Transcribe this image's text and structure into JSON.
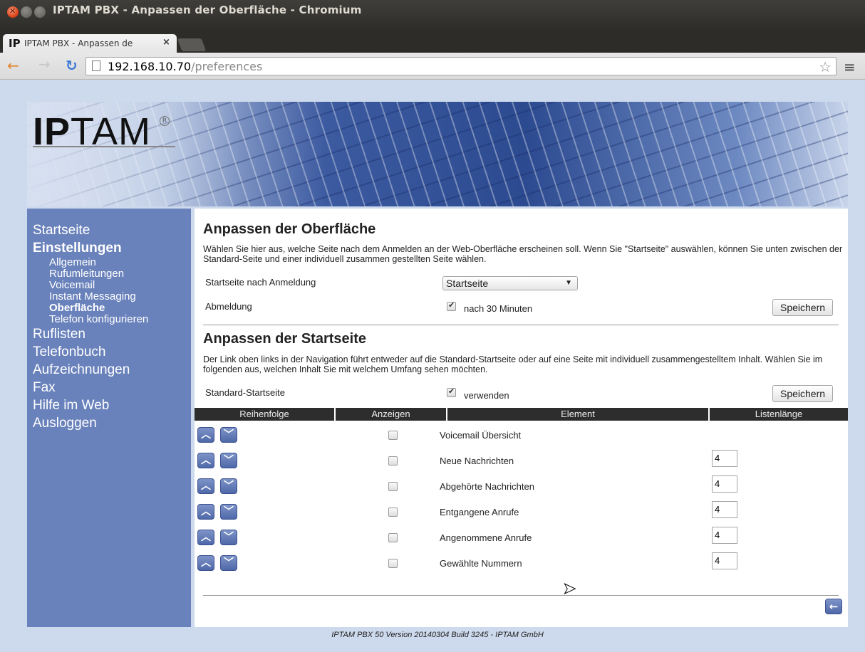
{
  "window": {
    "title": "IPTAM PBX - Anpassen der Oberfläche - Chromium"
  },
  "tab": {
    "favicon": "IP",
    "title": "IPTAM PBX - Anpassen de",
    "close": "×"
  },
  "address_bar": {
    "host": "192.168.10.70",
    "path": "/preferences"
  },
  "icons": {
    "back": "←",
    "forward": "→",
    "reload": "↻",
    "star": "☆",
    "menu": "≡",
    "up": "^",
    "down": "v",
    "page_back": "←",
    "checkmark": "✔"
  },
  "banner": {
    "logo_ip": "IP",
    "logo_tam": "TAM",
    "logo_reg": "R"
  },
  "sidebar": {
    "items": [
      {
        "label": "Startseite",
        "level": 1,
        "active": false
      },
      {
        "label": "Einstellungen",
        "level": 1,
        "active": true
      },
      {
        "label": "Allgemein",
        "level": 2,
        "active": false
      },
      {
        "label": "Rufumleitungen",
        "level": 2,
        "active": false
      },
      {
        "label": "Voicemail",
        "level": 2,
        "active": false
      },
      {
        "label": "Instant Messaging",
        "level": 2,
        "active": false
      },
      {
        "label": "Oberfläche",
        "level": 2,
        "active": true
      },
      {
        "label": "Telefon konfigurieren",
        "level": 2,
        "active": false
      },
      {
        "label": "Ruflisten",
        "level": 1,
        "active": false
      },
      {
        "label": "Telefonbuch",
        "level": 1,
        "active": false
      },
      {
        "label": "Aufzeichnungen",
        "level": 1,
        "active": false
      },
      {
        "label": "Fax",
        "level": 1,
        "active": false
      },
      {
        "label": "Hilfe im Web",
        "level": 1,
        "active": false
      },
      {
        "label": "Ausloggen",
        "level": 1,
        "active": false
      }
    ]
  },
  "section1": {
    "heading": "Anpassen der Oberfläche",
    "description": "Wählen Sie hier aus, welche Seite nach dem Anmelden an der Web-Oberfläche erscheinen soll. Wenn Sie \"Startseite\" auswählen, können Sie unten zwischen der Standard-Seite und einer individuell zusammen gestellten Seite wählen.",
    "start_label": "Startseite nach Anmeldung",
    "start_value": "Startseite",
    "logout_label": "Abmeldung",
    "logout_checked": true,
    "logout_value": "nach 30 Minuten",
    "save": "Speichern"
  },
  "section2": {
    "heading": "Anpassen der Startseite",
    "description": "Der Link oben links in der Navigation führt entweder auf die Standard-Startseite oder auf eine Seite mit individuell zusammengestelltem Inhalt. Wählen Sie im folgenden aus, welchen Inhalt Sie mit welchem Umfang sehen möchten.",
    "standard_label": "Standard-Startseite",
    "standard_checked": true,
    "standard_value": "verwenden",
    "save": "Speichern"
  },
  "table": {
    "headers": [
      "Reihenfolge",
      "Anzeigen",
      "Element",
      "Listenlänge"
    ],
    "rows": [
      {
        "element": "Voicemail Übersicht",
        "show": false,
        "length": ""
      },
      {
        "element": "Neue Nachrichten",
        "show": false,
        "length": "4"
      },
      {
        "element": "Abgehörte Nachrichten",
        "show": false,
        "length": "4"
      },
      {
        "element": "Entgangene Anrufe",
        "show": false,
        "length": "4"
      },
      {
        "element": "Angenommene Anrufe",
        "show": false,
        "length": "4"
      },
      {
        "element": "Gewählte Nummern",
        "show": false,
        "length": "4"
      }
    ]
  },
  "footer": {
    "text": "IPTAM PBX 50 Version 20140304 Build 3245 - IPTAM GmbH"
  },
  "colors": {
    "sidebar": "#6a82bb",
    "page_bg": "#cdd9ec",
    "table_head": "#2d2d2d",
    "arrow_button": "#5a72b0"
  }
}
